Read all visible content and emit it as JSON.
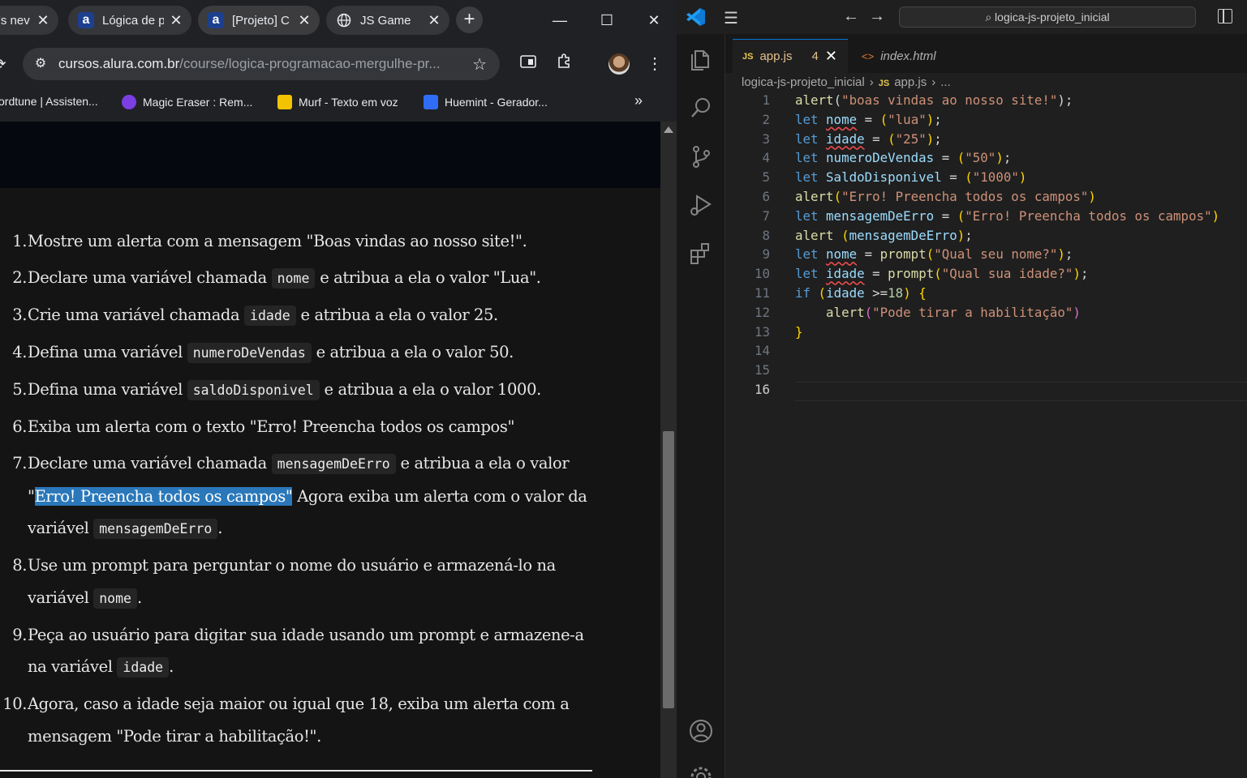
{
  "browser": {
    "tabs": [
      {
        "label": "'s nev",
        "favicon": "generic"
      },
      {
        "label": "Lógica de p",
        "favicon": "alura-a"
      },
      {
        "label": "[Projeto] C",
        "favicon": "alura-a"
      },
      {
        "label": "JS Game",
        "favicon": "globe-icon"
      }
    ],
    "tab_close_glyph": "✕",
    "new_tab_glyph": "+",
    "window_controls": {
      "minimize": "—",
      "maximize": "☐",
      "close": "✕"
    },
    "url_host": "cursos.alura.com.br",
    "url_path": "/course/logica-programacao-mergulhe-pr...",
    "bookmarks": [
      {
        "label": "ordtune | Assisten...",
        "icon_color": "#202124"
      },
      {
        "label": "Magic Eraser : Rem...",
        "icon_color": "#7b3fe4"
      },
      {
        "label": "Murf - Texto em voz",
        "icon_color": "#f2c300"
      },
      {
        "label": "Huemint - Gerador...",
        "icon_color": "#2f6df6"
      }
    ],
    "bookmarks_overflow": "»",
    "instructions": [
      {
        "num": "1.",
        "parts": [
          {
            "t": "Mostre um alerta com a mensagem \"Boas vindas ao nosso site!\"."
          }
        ]
      },
      {
        "num": "2.",
        "parts": [
          {
            "t": "Declare uma variável chamada "
          },
          {
            "code": "nome"
          },
          {
            "t": " e atribua a ela o valor \"Lua\"."
          }
        ]
      },
      {
        "num": "3.",
        "parts": [
          {
            "t": "Crie uma variável chamada "
          },
          {
            "code": "idade"
          },
          {
            "t": " e atribua a ela o valor 25."
          }
        ]
      },
      {
        "num": "4.",
        "parts": [
          {
            "t": "Defina uma variável "
          },
          {
            "code": "numeroDeVendas"
          },
          {
            "t": " e atribua a ela o valor 50."
          }
        ]
      },
      {
        "num": "5.",
        "parts": [
          {
            "t": "Defina uma variável "
          },
          {
            "code": "saldoDisponivel"
          },
          {
            "t": " e atribua a ela o valor 1000."
          }
        ]
      },
      {
        "num": "6.",
        "parts": [
          {
            "t": "Exiba um alerta com o texto \"Erro! Preencha todos os campos\""
          }
        ]
      },
      {
        "num": "7.",
        "parts": [
          {
            "t": "Declare uma variável chamada "
          },
          {
            "code": "mensagemDeErro"
          },
          {
            "t": " e atribua a ela o valor \""
          },
          {
            "hl": "Erro! Preencha todos os campos\""
          },
          {
            "t": " Agora exiba um alerta com o valor da variável "
          },
          {
            "code": "mensagemDeErro"
          },
          {
            "t": "."
          }
        ]
      },
      {
        "num": "8.",
        "parts": [
          {
            "t": "Use um prompt para perguntar o nome do usuário e armazená-lo na variável "
          },
          {
            "code": "nome"
          },
          {
            "t": "."
          }
        ]
      },
      {
        "num": "9.",
        "parts": [
          {
            "t": "Peça ao usuário para digitar sua idade usando um prompt e armazene-a na variável "
          },
          {
            "code": "idade"
          },
          {
            "t": "."
          }
        ]
      },
      {
        "num": "10.",
        "parts": [
          {
            "t": "Agora, caso a idade seja maior ou igual que 18, exiba um alerta com a mensagem \"Pode tirar a habilitação!\"."
          }
        ]
      }
    ]
  },
  "vscode": {
    "search_text": "logica-js-projeto_inicial",
    "tabs": [
      {
        "label": "app.js",
        "badge": "4",
        "active": true
      },
      {
        "label": "index.html",
        "active": false
      }
    ],
    "breadcrumb": {
      "folder": "logica-js-projeto_inicial",
      "file": "app.js",
      "tail": "..."
    },
    "current_line": 16,
    "code_lines": [
      [
        [
          "fn",
          "alert"
        ],
        [
          "p",
          "("
        ],
        [
          "str",
          "\"boas vindas ao nosso site!\""
        ],
        [
          "p",
          ");"
        ]
      ],
      [
        [
          "kw",
          "let "
        ],
        [
          "var-warn",
          "nome"
        ],
        [
          "p",
          " = "
        ],
        [
          "pb1",
          "("
        ],
        [
          "str",
          "\"lua\""
        ],
        [
          "pb1",
          ")"
        ],
        [
          "p",
          ";"
        ]
      ],
      [
        [
          "kw",
          "let "
        ],
        [
          "var-warn",
          "idade"
        ],
        [
          "p",
          " = "
        ],
        [
          "pb1",
          "("
        ],
        [
          "str",
          "\"25\""
        ],
        [
          "pb1",
          ")"
        ],
        [
          "p",
          ";"
        ]
      ],
      [
        [
          "kw",
          "let "
        ],
        [
          "var",
          "numeroDeVendas"
        ],
        [
          "p",
          " = "
        ],
        [
          "pb1",
          "("
        ],
        [
          "str",
          "\"50\""
        ],
        [
          "pb1",
          ")"
        ],
        [
          "p",
          ";"
        ]
      ],
      [
        [
          "kw",
          "let "
        ],
        [
          "var",
          "SaldoDisponivel"
        ],
        [
          "p",
          " = "
        ],
        [
          "pb1",
          "("
        ],
        [
          "str",
          "\"1000\""
        ],
        [
          "pb1",
          ")"
        ]
      ],
      [
        [
          "fn",
          "alert"
        ],
        [
          "pb1",
          "("
        ],
        [
          "str",
          "\"Erro! Preencha todos os campos\""
        ],
        [
          "pb1",
          ")"
        ]
      ],
      [
        [
          "kw",
          "let "
        ],
        [
          "var",
          "mensagemDeErro"
        ],
        [
          "p",
          " = "
        ],
        [
          "pb1",
          "("
        ],
        [
          "str",
          "\"Erro! Preencha todos os campos\""
        ],
        [
          "pb1",
          ")"
        ]
      ],
      [
        [
          "fn",
          "alert "
        ],
        [
          "pb1",
          "("
        ],
        [
          "var",
          "mensagemDeErro"
        ],
        [
          "pb1",
          ")"
        ],
        [
          "p",
          ";"
        ]
      ],
      [
        [
          "kw",
          "let "
        ],
        [
          "var-warn",
          "nome"
        ],
        [
          "p",
          " = "
        ],
        [
          "fn",
          "prompt"
        ],
        [
          "pb1",
          "("
        ],
        [
          "str",
          "\"Qual seu nome?\""
        ],
        [
          "pb1",
          ")"
        ],
        [
          "p",
          ";"
        ]
      ],
      [
        [
          "kw",
          "let "
        ],
        [
          "var-warn",
          "idade"
        ],
        [
          "p",
          " = "
        ],
        [
          "fn",
          "prompt"
        ],
        [
          "pb1",
          "("
        ],
        [
          "str",
          "\"Qual sua idade?\""
        ],
        [
          "pb1",
          ")"
        ],
        [
          "p",
          ";"
        ]
      ],
      [
        [
          "kw",
          "if "
        ],
        [
          "pb1",
          "("
        ],
        [
          "var",
          "idade "
        ],
        [
          "p",
          ">="
        ],
        [
          "num",
          "18"
        ],
        [
          "pb1",
          ")"
        ],
        [
          "p",
          " "
        ],
        [
          "pb1",
          "{"
        ]
      ],
      [
        [
          "p",
          "    "
        ],
        [
          "fn",
          "alert"
        ],
        [
          "pb2",
          "("
        ],
        [
          "str",
          "\"Pode tirar a habilitação\""
        ],
        [
          "pb2",
          ")"
        ]
      ],
      [
        [
          "pb1",
          "}"
        ]
      ],
      [],
      [],
      []
    ]
  }
}
